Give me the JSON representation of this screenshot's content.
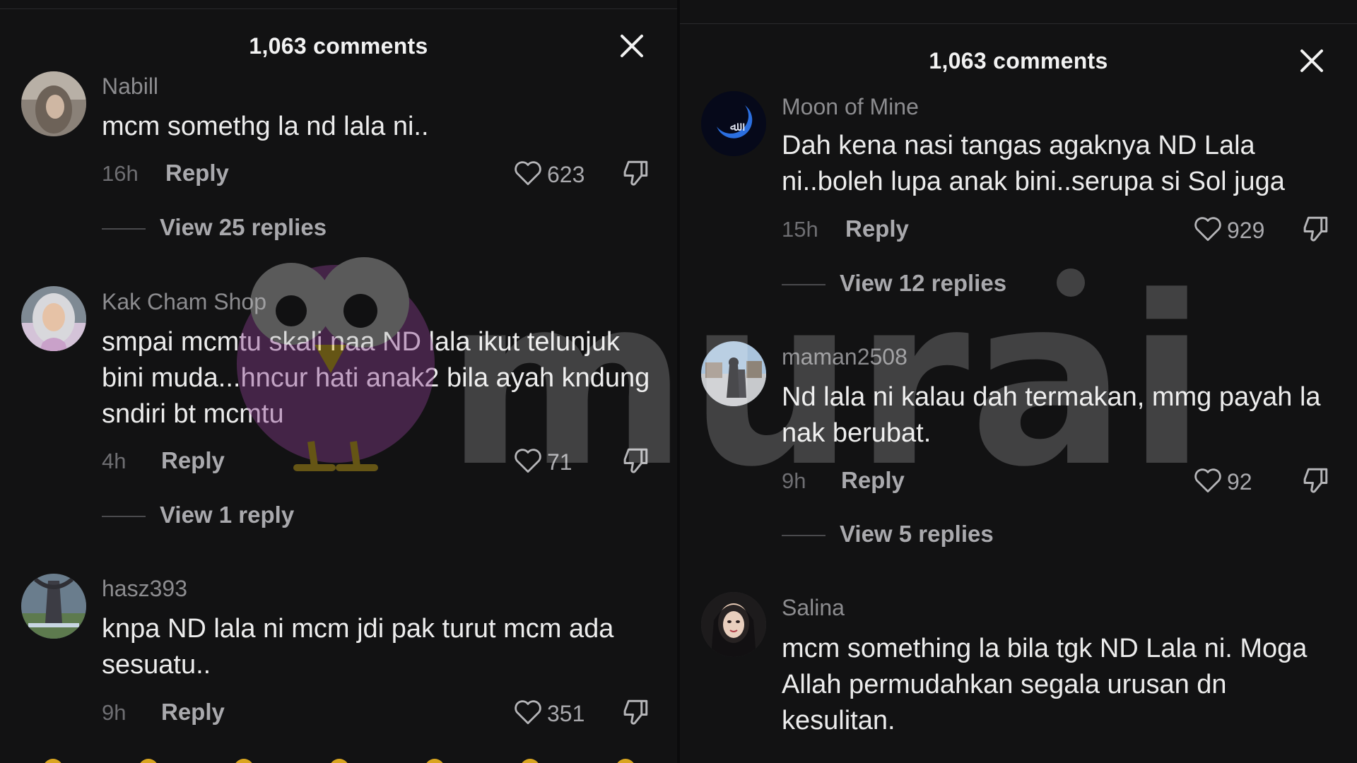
{
  "left_panel": {
    "header": {
      "title": "1,063 comments",
      "close_label": "×"
    },
    "comments": [
      {
        "username": "Nabill",
        "text": "mcm somethg la nd lala ni..",
        "time": "16h",
        "reply_label": "Reply",
        "likes": "623",
        "view_replies": "View 25 replies"
      },
      {
        "username": "Kak Cham Shop",
        "text": "smpai mcmtu skali naa ND lala ikut telunjuk bini muda...hncur hati anak2 bila ayah kndung sndiri bt mcmtu",
        "time": "4h",
        "reply_label": "Reply",
        "likes": "71",
        "view_replies": "View 1 reply"
      },
      {
        "username": "hasz393",
        "text": "knpa ND lala ni mcm jdi pak turut mcm ada sesuatu..",
        "time": "9h",
        "reply_label": "Reply",
        "likes": "351"
      }
    ]
  },
  "right_panel": {
    "header": {
      "title": "1,063 comments",
      "close_label": "×"
    },
    "comments": [
      {
        "username": "Moon of Mine",
        "text": "Dah kena nasi tangas agaknya ND Lala ni..boleh lupa anak bini..serupa si Sol juga",
        "time": "15h",
        "reply_label": "Reply",
        "likes": "929",
        "view_replies": "View 12 replies"
      },
      {
        "username": "maman2508",
        "text": "Nd lala ni kalau dah termakan, mmg payah la nak berubat.",
        "time": "9h",
        "reply_label": "Reply",
        "likes": "92",
        "view_replies": "View 5 replies"
      },
      {
        "username": "Salina",
        "text": "mcm something la bila tgk ND Lala ni. Moga Allah permudahkan segala urusan dn kesulitan."
      }
    ]
  },
  "watermark": {
    "text": "murai"
  },
  "icons": {
    "like": "heart-outline-icon",
    "dislike": "thumbs-down-icon",
    "close": "close-icon"
  },
  "colors": {
    "background": "#121213",
    "text_primary": "#ececec",
    "text_secondary": "#a9a9ad",
    "username": "#8c8c8f",
    "watermark_purple": "#8a3f8f",
    "watermark_yellow": "#d9b21a"
  }
}
